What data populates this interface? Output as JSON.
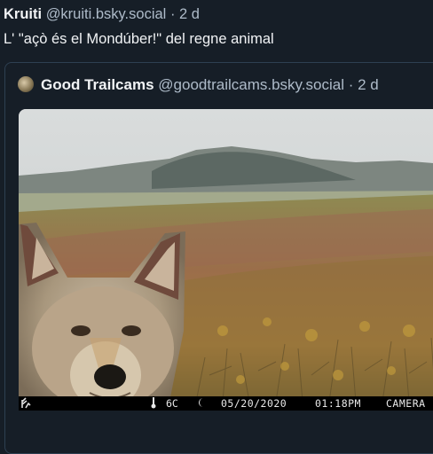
{
  "post": {
    "author_name": "Kruiti",
    "author_handle": "@kruiti.bsky.social",
    "separator": "·",
    "time": "2 d",
    "text": "L' \"açò és el Mondúber!\" del regne animal"
  },
  "quote": {
    "author_name": "Good Trailcams",
    "author_handle": "@goodtrailcams.bsky.social",
    "separator": "·",
    "time": "2 d",
    "avatar_icon": "trailcam-avatar"
  },
  "media": {
    "description_icon": "coyote-photo",
    "camera_bar": {
      "logo_icon": "brand-antler-icon",
      "temp_icon": "thermometer-icon",
      "temperature": "6C",
      "moon_icon": "crescent-moon-icon",
      "date": "05/20/2020",
      "time": "01:18PM",
      "label": "CAMERA"
    }
  },
  "colors": {
    "background": "#161e27",
    "text_primary": "#f1f3f5",
    "text_secondary": "#aebbc9",
    "card_border": "#2e4052"
  }
}
